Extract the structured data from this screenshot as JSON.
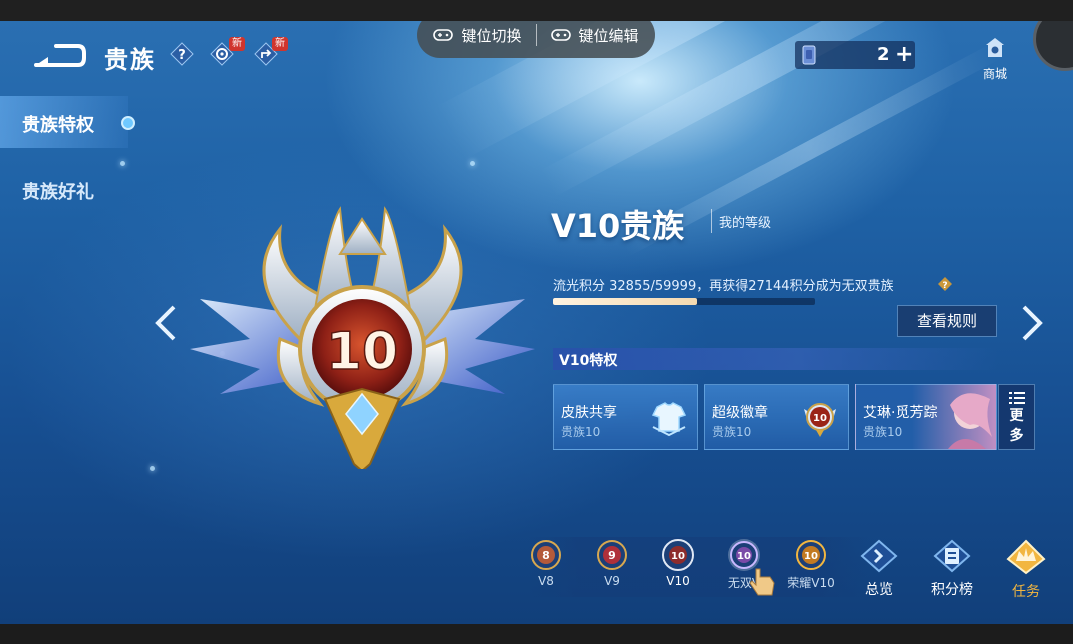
{
  "header": {
    "title": "贵族",
    "new_badge_1": "新",
    "new_badge_2": "新",
    "currency_value": "2",
    "shop_label": "商城"
  },
  "overlay": {
    "key_switch": "键位切换",
    "key_edit": "键位编辑"
  },
  "sidebar": {
    "items": [
      {
        "label": "贵族特权",
        "active": true
      },
      {
        "label": "贵族好礼",
        "active": false
      }
    ]
  },
  "emblem": {
    "level_number": "10"
  },
  "level": {
    "title": "V10贵族",
    "my_level": "我的等级",
    "progress_text": "流光积分 32855/59999，再获得27144积分成为无双贵族",
    "progress_fraction": 0.548,
    "rules_button": "查看规则"
  },
  "privileges": {
    "header": "V10特权",
    "cards": [
      {
        "title": "皮肤共享",
        "sub": "贵族10",
        "icon": "shirt-icon"
      },
      {
        "title": "超级徽章",
        "sub": "贵族10",
        "icon": "medal-icon"
      },
      {
        "title": "艾琳·觅芳踪",
        "sub": "贵族10",
        "icon": "hero-portrait"
      }
    ],
    "more_line1": "更",
    "more_line2": "多"
  },
  "tabs": [
    {
      "badge": "8",
      "label": "V8",
      "color": "#b45a3a"
    },
    {
      "badge": "9",
      "label": "V9",
      "color": "#b0303a"
    },
    {
      "badge": "10",
      "label": "V10",
      "color": "#8e2c2c"
    },
    {
      "badge": "10",
      "label": "无双V",
      "color": "#7a4aa8"
    },
    {
      "badge": "10",
      "label": "荣耀V10",
      "color": "#c27a22"
    }
  ],
  "nav": {
    "overview": "总览",
    "ranking": "积分榜",
    "tasks": "任务"
  },
  "colors": {
    "accent_gold": "#f2b640",
    "panel_blue": "#1f62a6"
  }
}
